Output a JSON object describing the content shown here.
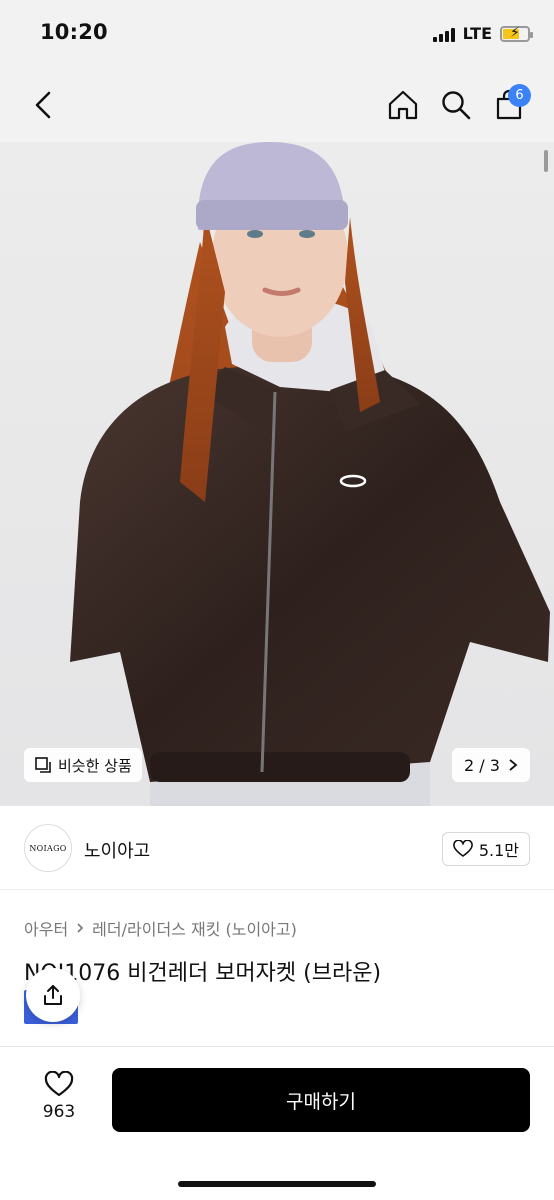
{
  "status_bar": {
    "time": "10:20",
    "network": "LTE",
    "battery_color": "#f5c518"
  },
  "nav": {
    "back_icon": "chevron-left-icon",
    "home_icon": "home-icon",
    "search_icon": "search-icon",
    "cart_icon": "shopping-bag-icon",
    "cart_count": "6",
    "badge_color": "#3b82f6"
  },
  "gallery": {
    "similar_label": "비슷한 상품",
    "pager_current": "2",
    "pager_separator": "/",
    "pager_total": "3"
  },
  "brand": {
    "logo_text": "NOIAGO",
    "name": "노이아고",
    "like_count": "5.1만"
  },
  "breadcrumb": [
    "아우터",
    "레더/라이더스 재킷 (노이아고)"
  ],
  "product": {
    "title": "NOI1076 비건레더 보머자켓 (브라운)"
  },
  "bottom_bar": {
    "wish_count": "963",
    "buy_label": "구매하기",
    "buy_color": "#000000"
  }
}
